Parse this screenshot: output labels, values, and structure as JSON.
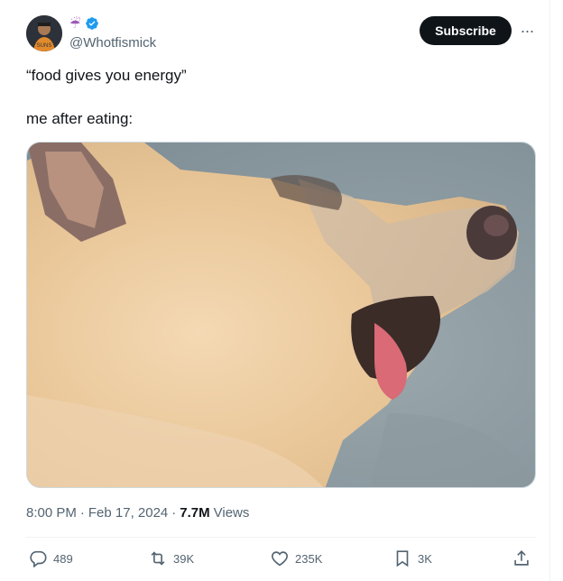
{
  "author": {
    "handle": "@Whotfismick",
    "name_emoji": "☔",
    "verified": true,
    "avatar_icon": "avatar-person-icon"
  },
  "subscribe_label": "Subscribe",
  "more_label": "···",
  "tweet": {
    "line1": "“food gives you energy”",
    "line2": "me after eating:"
  },
  "media": {
    "alt_icon": "dog-photo"
  },
  "meta": {
    "time": "8:00 PM",
    "sep1": "·",
    "date": "Feb 17, 2024",
    "sep2": "·",
    "views_count": "7.7M",
    "views_label": "Views"
  },
  "actions": {
    "replies": "489",
    "retweets": "39K",
    "likes": "235K",
    "bookmarks": "3K"
  },
  "colors": {
    "verified": "#1d9bf0",
    "secondary_text": "#536471",
    "primary_text": "#0f1419"
  }
}
